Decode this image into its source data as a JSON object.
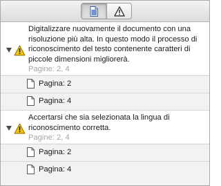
{
  "toolbar": {
    "tabs": [
      {
        "icon": "document-icon",
        "selected": true
      },
      {
        "icon": "warning-icon",
        "selected": false
      }
    ]
  },
  "issues": [
    {
      "message": "Digitalizzare nuovamente il documento con una risoluzione più alta. In questo modo il processo di riconoscimento del testo contenente caratteri di piccole dimensioni migliorerà.",
      "pages": "Pagine: 2, 4",
      "icon": "warning-icon",
      "expanded": true,
      "children": [
        {
          "label": "Pagina: 2",
          "icon": "page-icon"
        },
        {
          "label": "Pagina: 4",
          "icon": "page-icon"
        }
      ]
    },
    {
      "message": "Accertarsi che sia selezionata la lingua di riconoscimento corretta.",
      "pages": "Pagine: 2, 4",
      "icon": "warning-icon",
      "expanded": true,
      "children": [
        {
          "label": "Pagina: 2",
          "icon": "page-icon"
        },
        {
          "label": "Pagina: 4",
          "icon": "page-icon"
        }
      ]
    }
  ],
  "colors": {
    "warning_fill": "#f5c400",
    "text": "#1a1a1a",
    "muted": "#a5a5a5"
  }
}
